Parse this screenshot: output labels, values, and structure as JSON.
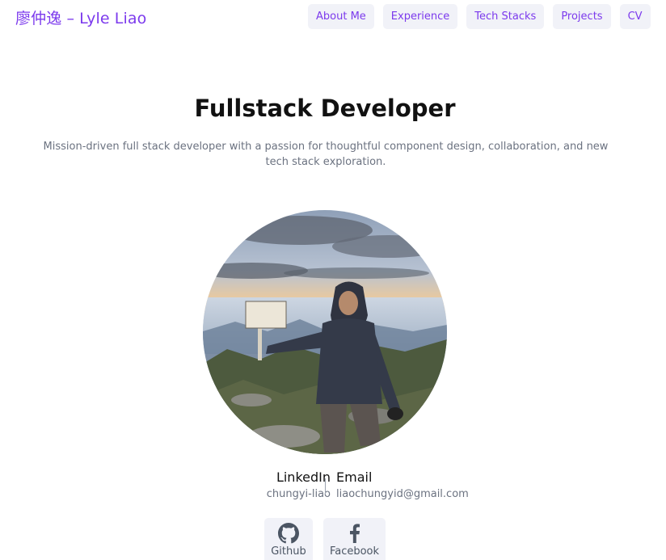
{
  "header": {
    "brand": "廖仲逸 – Lyle Liao",
    "nav": [
      {
        "label": "About Me"
      },
      {
        "label": "Experience"
      },
      {
        "label": "Tech Stacks"
      },
      {
        "label": "Projects"
      },
      {
        "label": "CV"
      }
    ]
  },
  "hero": {
    "title": "Fullstack Developer",
    "subtitle": "Mission-driven full stack developer with a passion for thoughtful component design, collaboration, and new tech stack exploration."
  },
  "contact": {
    "linkedin": {
      "label": "LinkedIn",
      "value": "chungyi-liao"
    },
    "email": {
      "label": "Email",
      "value": "liaochungyid@gmail.com"
    }
  },
  "social": {
    "github": {
      "label": "Github",
      "icon": "github-icon"
    },
    "facebook": {
      "label": "Facebook",
      "icon": "facebook-icon"
    }
  },
  "colors": {
    "accent": "#7c3aed",
    "button_bg": "#f1f2f8",
    "muted_text": "#6b7280"
  }
}
